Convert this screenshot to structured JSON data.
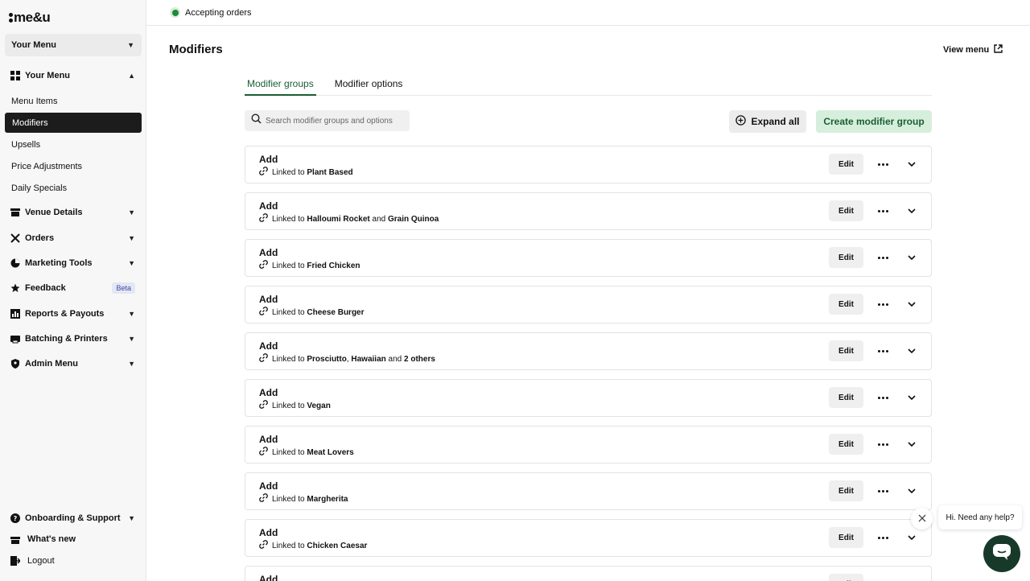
{
  "brand": {
    "logo_text": "me&u"
  },
  "sidebar": {
    "menu_select": "Your Menu",
    "sections": [
      {
        "label": "Your Menu",
        "icon": "grid-icon"
      },
      {
        "label": "Venue Details",
        "icon": "store-icon"
      },
      {
        "label": "Orders",
        "icon": "utensils-icon"
      },
      {
        "label": "Marketing Tools",
        "icon": "pie-chart-icon"
      },
      {
        "label": "Feedback",
        "icon": "star-icon",
        "badge": "Beta"
      },
      {
        "label": "Reports & Payouts",
        "icon": "bar-chart-icon"
      },
      {
        "label": "Batching & Printers",
        "icon": "printer-icon"
      },
      {
        "label": "Admin Menu",
        "icon": "shield-icon"
      }
    ],
    "sub_items": [
      "Menu Items",
      "Modifiers",
      "Upsells",
      "Price Adjustments",
      "Daily Specials"
    ],
    "active_sub": "Modifiers",
    "footer": [
      {
        "label": "Onboarding & Support",
        "icon": "help-icon"
      },
      {
        "label": "What's new",
        "icon": "gift-icon"
      },
      {
        "label": "Logout",
        "icon": "logout-icon"
      }
    ]
  },
  "topbar": {
    "status": "Accepting orders",
    "status_color": "#1e8a3a"
  },
  "page": {
    "title": "Modifiers",
    "view_menu": "View menu",
    "tabs": [
      "Modifier groups",
      "Modifier options"
    ],
    "search_placeholder": "Search modifier groups and options",
    "expand_all": "Expand all",
    "create": "Create modifier group"
  },
  "rows": [
    {
      "title": "Add",
      "prefix": "Linked to",
      "parts": [
        {
          "t": "Plant Based",
          "b": true
        }
      ]
    },
    {
      "title": "Add",
      "prefix": "Linked to",
      "parts": [
        {
          "t": "Halloumi Rocket",
          "b": true
        },
        {
          "t": " and ",
          "b": false
        },
        {
          "t": "Grain Quinoa",
          "b": true
        }
      ]
    },
    {
      "title": "Add",
      "prefix": "Linked to",
      "parts": [
        {
          "t": "Fried Chicken",
          "b": true
        }
      ]
    },
    {
      "title": "Add",
      "prefix": "Linked to",
      "parts": [
        {
          "t": "Cheese Burger",
          "b": true
        }
      ]
    },
    {
      "title": "Add",
      "prefix": "Linked to",
      "parts": [
        {
          "t": "Prosciutto",
          "b": true
        },
        {
          "t": ", ",
          "b": false
        },
        {
          "t": "Hawaiian",
          "b": true
        },
        {
          "t": " and ",
          "b": false
        },
        {
          "t": "2 others",
          "b": true
        }
      ]
    },
    {
      "title": "Add",
      "prefix": "Linked to",
      "parts": [
        {
          "t": "Vegan",
          "b": true
        }
      ]
    },
    {
      "title": "Add",
      "prefix": "Linked to",
      "parts": [
        {
          "t": "Meat Lovers",
          "b": true
        }
      ]
    },
    {
      "title": "Add",
      "prefix": "Linked to",
      "parts": [
        {
          "t": "Margherita",
          "b": true
        }
      ]
    },
    {
      "title": "Add",
      "prefix": "Linked to",
      "parts": [
        {
          "t": "Chicken Caesar",
          "b": true
        }
      ]
    },
    {
      "title": "Add",
      "prefix": "",
      "parts": []
    }
  ],
  "row_edit_label": "Edit",
  "chat": {
    "greeting": "Hi. Need any help?"
  }
}
